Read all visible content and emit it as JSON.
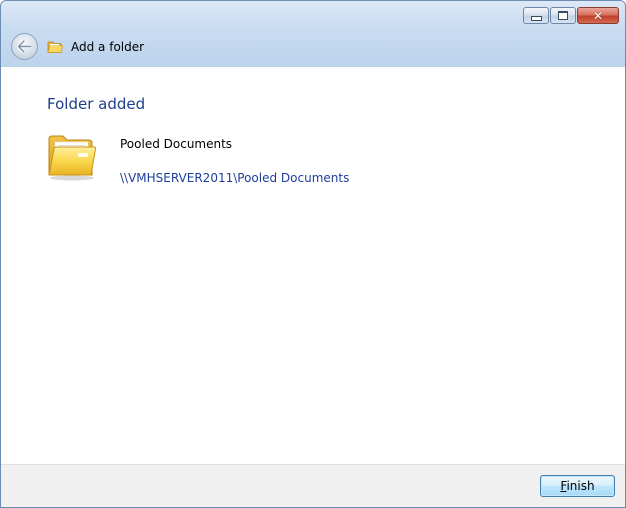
{
  "window": {
    "title": "Add a folder",
    "controls": {
      "minimize_icon": "minimize-icon",
      "maximize_icon": "maximize-icon",
      "close_icon": "close-icon"
    },
    "back_icon": "back-arrow-icon",
    "title_icon": "folder-icon"
  },
  "main": {
    "heading": "Folder added",
    "folder_icon": "large-folder-icon",
    "folder_name": "Pooled Documents",
    "folder_path": "\\\\VMHSERVER2011\\Pooled Documents"
  },
  "footer": {
    "finish_label_access_key": "F",
    "finish_label_rest": "inish"
  },
  "colors": {
    "heading": "#1e3f8c",
    "link": "#1e3f9a",
    "titlebar": "#c9dcf1",
    "footer": "#f0f0f0"
  }
}
